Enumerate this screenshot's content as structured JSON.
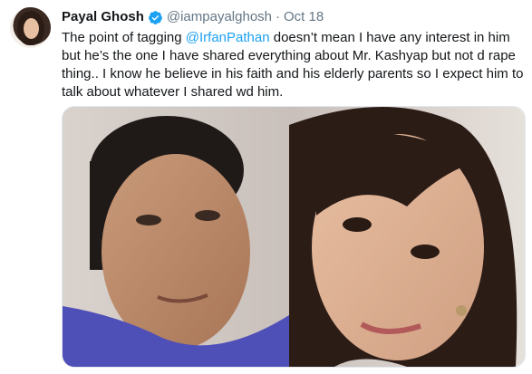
{
  "author": {
    "name": "Payal Ghosh",
    "handle": "@iampayalghosh",
    "separator": "·",
    "date": "Oct 18",
    "verified": true,
    "verified_color": "#1da1f2"
  },
  "tweet": {
    "line1_pre": "The point of tagging ",
    "line1_mention": "@IrfanPathan",
    "line1_post": " doesn’t mean I have any interest in him",
    "line2": "but he’s the one I have shared everything about Mr. Kashyap but not d  rape",
    "line3": "thing.. I know he believe in his faith and his elderly parents so I expect him to",
    "line4": "talk about whatever I shared wd him."
  },
  "colors": {
    "mention": "#1da1f2",
    "text": "#14171a",
    "secondary": "#657786"
  },
  "icons": {
    "verified": "verified-badge-icon"
  }
}
